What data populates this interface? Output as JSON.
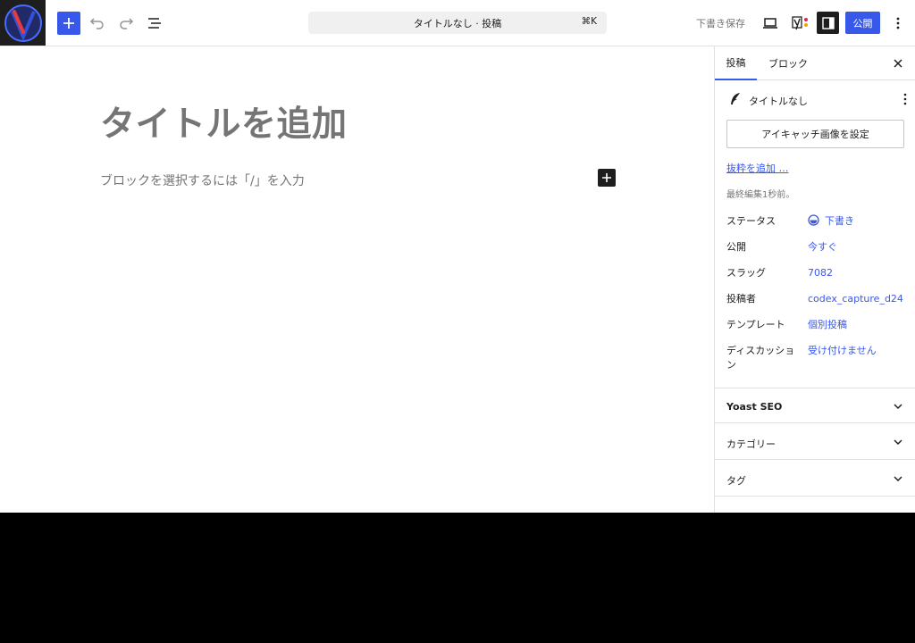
{
  "header": {
    "doc_title": "タイトルなし · 投稿",
    "shortcut": "⌘K",
    "save_draft": "下書き保存",
    "publish": "公開"
  },
  "canvas": {
    "title_placeholder": "タイトルを追加",
    "block_placeholder": "ブロックを選択するには「/」を入力"
  },
  "sidebar": {
    "tabs": [
      "投稿",
      "ブロック"
    ],
    "post_title": "タイトルなし",
    "featured_image": "アイキャッチ画像を設定",
    "excerpt_link": "抜粋を追加 …",
    "last_edited": "最終編集1秒前。",
    "meta": [
      {
        "label": "ステータス",
        "value": "下書き"
      },
      {
        "label": "公開",
        "value": "今すぐ"
      },
      {
        "label": "スラッグ",
        "value": "7082"
      },
      {
        "label": "投稿者",
        "value": "codex_capture_d24"
      },
      {
        "label": "テンプレート",
        "value": "個別投稿"
      },
      {
        "label": "ディスカッション",
        "value": "受け付けません"
      }
    ],
    "panels": [
      "Yoast SEO",
      "カテゴリー",
      "タグ"
    ]
  },
  "colors": {
    "accent": "#3858e9",
    "text": "#1e1e1e",
    "muted": "#757575"
  },
  "icons": {
    "site_logo": "site-logo",
    "add": "plus-icon",
    "undo": "undo-icon",
    "redo": "redo-icon",
    "outline": "list-view-icon",
    "preview": "laptop-icon",
    "yoast": "yoast-icon",
    "sidebar": "sidebar-toggle-icon",
    "more": "more-vertical-icon",
    "close": "close-icon",
    "feather": "feather-icon",
    "status": "draft-status-icon",
    "chevron": "chevron-down-icon"
  }
}
